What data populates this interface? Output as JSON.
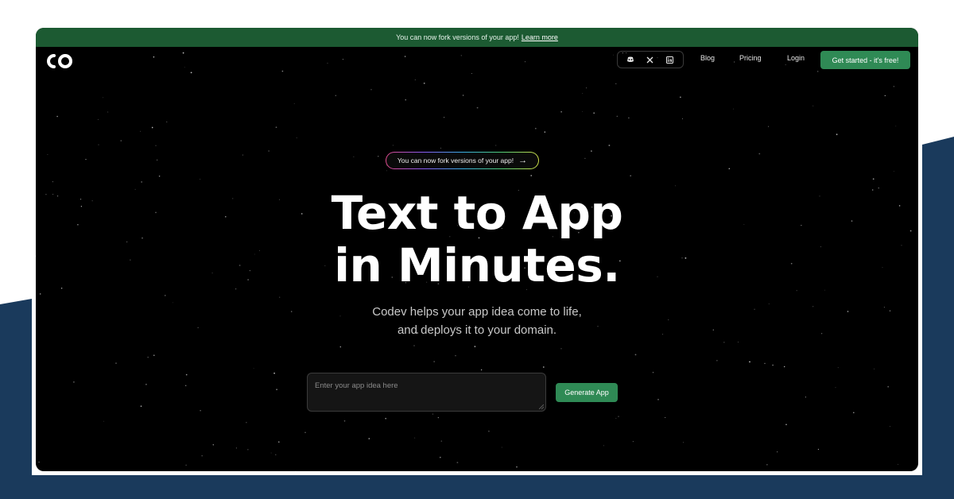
{
  "colors": {
    "banner_bg": "#1c5a32",
    "accent_green": "#2f8a55",
    "page_bg": "#000000",
    "outer_shape": "#1a3a5c"
  },
  "banner": {
    "text": "You can now fork versions of your app!",
    "link": "Learn more"
  },
  "header": {
    "logo": "co-logo",
    "social_icons": [
      "discord-icon",
      "x-icon",
      "linkedin-icon"
    ],
    "nav": [
      "Blog",
      "Pricing",
      "Login"
    ],
    "cta": "Get started - it's free!"
  },
  "hero": {
    "pill_text": "You can now fork versions of your app!",
    "pill_arrow": "→",
    "headline_line1": "Text to App",
    "headline_line2": "in Minutes.",
    "sub_line1": "Codev helps your app idea come to life,",
    "sub_line2": "and deploys it to your domain.",
    "input_placeholder": "Enter your app idea here",
    "button": "Generate App"
  }
}
